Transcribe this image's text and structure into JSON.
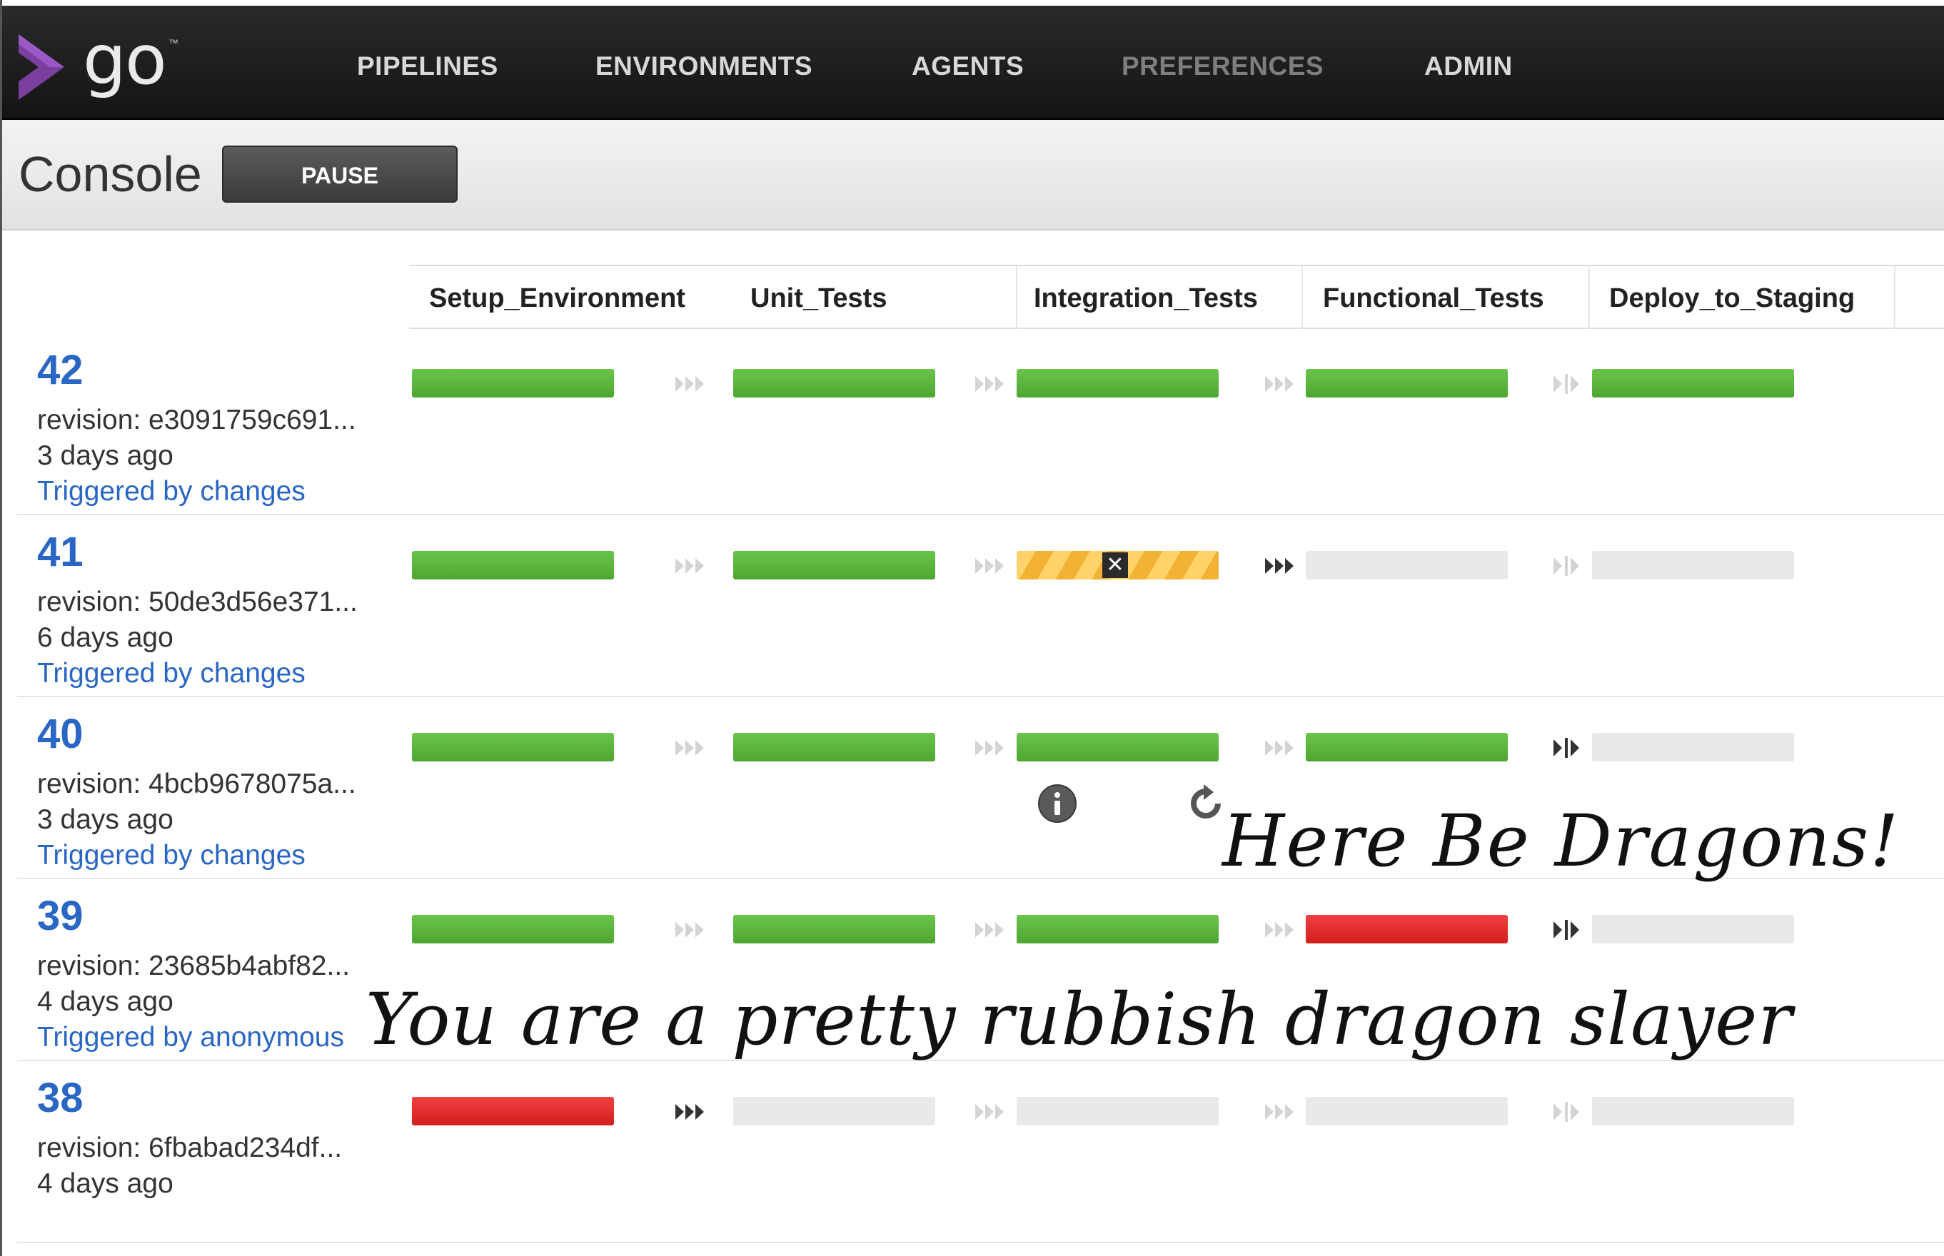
{
  "app": {
    "logo_text": "go",
    "logo_tm": "™"
  },
  "nav": {
    "items": [
      {
        "label": "PIPELINES"
      },
      {
        "label": "ENVIRONMENTS"
      },
      {
        "label": "AGENTS"
      },
      {
        "label": "PREFERENCES"
      },
      {
        "label": "ADMIN"
      }
    ]
  },
  "console": {
    "title": "Console",
    "pause_label": "PAUSE"
  },
  "stages": [
    "Setup_Environment",
    "Unit_Tests",
    "Integration_Tests",
    "Functional_Tests",
    "Deploy_to_Staging"
  ],
  "colors": {
    "passed": "#5cb83d",
    "failed": "#e02b2a",
    "cancelled": "#f2b233",
    "link": "#2a66c4"
  },
  "rows": [
    {
      "counter": "42",
      "revision": "revision: e3091759c691...",
      "ago": "3 days ago",
      "trigger": "Triggered by changes",
      "statuses": [
        "passed",
        "passed",
        "passed",
        "passed",
        "passed"
      ]
    },
    {
      "counter": "41",
      "revision": "revision: 50de3d56e371...",
      "ago": "6 days ago",
      "trigger": "Triggered by changes",
      "statuses": [
        "passed",
        "passed",
        "cancelled",
        "empty",
        "empty"
      ]
    },
    {
      "counter": "40",
      "revision": "revision: 4bcb9678075a...",
      "ago": "3 days ago",
      "trigger": "Triggered by changes",
      "statuses": [
        "passed",
        "passed",
        "passed",
        "passed",
        "empty"
      ]
    },
    {
      "counter": "39",
      "revision": "revision: 23685b4abf82...",
      "ago": "4 days ago",
      "trigger": "Triggered by anonymous",
      "statuses": [
        "passed",
        "passed",
        "passed",
        "failed",
        "empty"
      ]
    },
    {
      "counter": "38",
      "revision": "revision: 6fbabad234df...",
      "ago": "4 days ago",
      "trigger": "",
      "statuses": [
        "failed",
        "empty",
        "empty",
        "empty",
        "empty"
      ]
    }
  ],
  "annotations": {
    "dragons": "Here Be Dragons!",
    "slayer": "You are a pretty rubbish dragon slayer"
  },
  "icons": {
    "info": "info-icon",
    "rerun": "rerun-icon",
    "cancelled": "close-icon"
  }
}
